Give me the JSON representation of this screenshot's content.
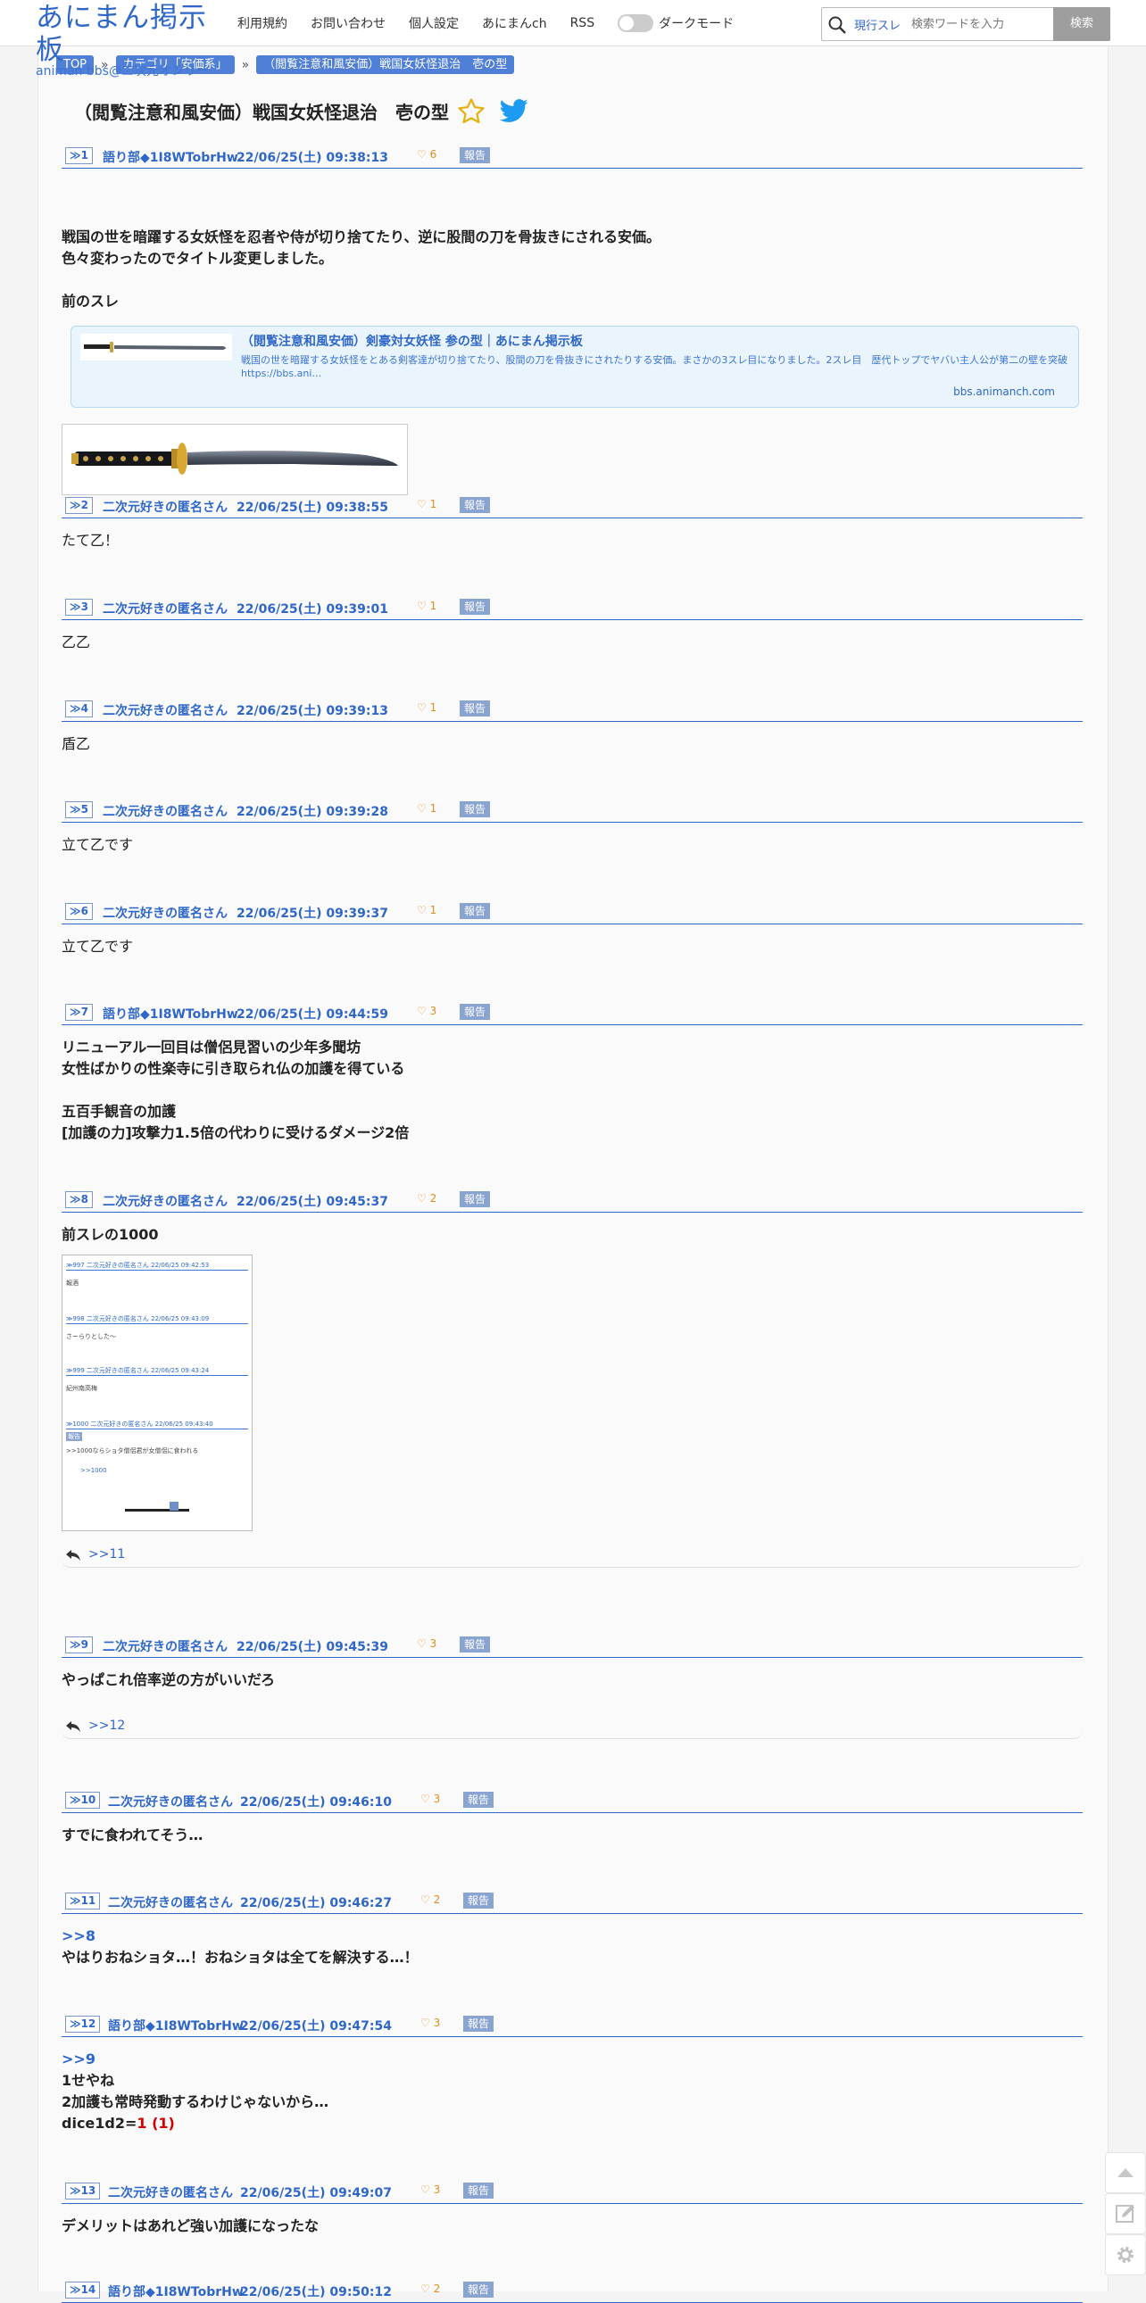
{
  "header": {
    "logo_title": "あにまん掲示板",
    "logo_subtitle": "animan bbs@二次元オンリー",
    "nav": [
      "利用規約",
      "お問い合わせ",
      "個人設定",
      "あにまんch",
      "RSS"
    ],
    "dark_mode_label": "ダークモード",
    "search_scope": "現行スレ",
    "search_placeholder": "検索ワードを入力",
    "search_button": "検索"
  },
  "breadcrumb": [
    "TOP",
    "カテゴリ「安価系」",
    "（閲覧注意和風安価）戦国女妖怪退治　壱の型"
  ],
  "thread_title": "（閲覧注意和風安価）戦国女妖怪退治　壱の型",
  "colors": {
    "accent": "#2f67c8",
    "like": "#e08d1f",
    "report": "#8aa4d2",
    "dice": "#d00000"
  },
  "posts": [
    {
      "num": "≫1",
      "name": "語り部◆1I8WTobrHw",
      "date": "22/06/25(土) 09:38:13",
      "likes": "6",
      "lines": [
        "戦国の世を暗躍する女妖怪を忍者や侍が切り捨てたり、逆に股間の刀を骨抜きにされる安価。",
        "色々変わったのでタイトル変更しました。",
        "",
        "前のスレ"
      ],
      "link_card": {
        "title": "（閲覧注意和風安価）剣豪対女妖怪 参の型｜あにまん掲示板",
        "desc": "戦国の世を暗躍する女妖怪をとある剣客達が切り捨てたり、股間の刀を骨抜きにされたりする安価。まさかの3スレ目になりました。2スレ目　歴代トップでヤバい主人公が第二の壁を突破https://bbs.ani…",
        "domain": "bbs.animanch.com"
      }
    },
    {
      "num": "≫2",
      "name": "二次元好きの匿名さん",
      "date": "22/06/25(土) 09:38:55",
      "likes": "1",
      "lines": [
        "たて乙！"
      ]
    },
    {
      "num": "≫3",
      "name": "二次元好きの匿名さん",
      "date": "22/06/25(土) 09:39:01",
      "likes": "1",
      "lines": [
        "乙乙"
      ]
    },
    {
      "num": "≫4",
      "name": "二次元好きの匿名さん",
      "date": "22/06/25(土) 09:39:13",
      "likes": "1",
      "lines": [
        "盾乙"
      ]
    },
    {
      "num": "≫5",
      "name": "二次元好きの匿名さん",
      "date": "22/06/25(土) 09:39:28",
      "likes": "1",
      "lines": [
        "立て乙です"
      ]
    },
    {
      "num": "≫6",
      "name": "二次元好きの匿名さん",
      "date": "22/06/25(土) 09:39:37",
      "likes": "1",
      "lines": [
        "立て乙です"
      ]
    },
    {
      "num": "≫7",
      "name": "語り部◆1I8WTobrHw",
      "date": "22/06/25(土) 09:44:59",
      "likes": "3",
      "lines": [
        "リニューアル一回目は僧侶見習いの少年多聞坊",
        "女性ばかりの性楽寺に引き取られ仏の加護を得ている",
        "",
        "五百手観音の加護",
        "[加護の力]攻撃力1.5倍の代わりに受けるダメージ2倍"
      ]
    },
    {
      "num": "≫8",
      "name": "二次元好きの匿名さん",
      "date": "22/06/25(土) 09:45:37",
      "likes": "2",
      "lines": [
        "前スレの1000"
      ],
      "replies": ">>11",
      "screenshot": {
        "rows": [
          {
            "meta": "≫997  二次元好きの匿名さん 22/06/25 09:42:53",
            "text": "報酒"
          },
          {
            "meta": "≫998  二次元好きの匿名さん 22/06/25 09:43:09",
            "text": "さーらりとした〜"
          },
          {
            "meta": "≫999  二次元好きの匿名さん 22/06/25 09:43:24",
            "text": "紀州南高梅"
          },
          {
            "meta": "≫1000  二次元好きの匿名さん 22/06/25 09:43:40",
            "text": ">>1000ならショタ僧侶君が女僧侶に食われる"
          }
        ],
        "reply": ">>1000",
        "report": "報告"
      }
    },
    {
      "num": "≫9",
      "name": "二次元好きの匿名さん",
      "date": "22/06/25(土) 09:45:39",
      "likes": "3",
      "lines": [
        "やっぱこれ倍率逆の方がいいだろ"
      ],
      "replies": ">>12"
    },
    {
      "num": "≫10",
      "name": "二次元好きの匿名さん",
      "date": "22/06/25(土) 09:46:10",
      "likes": "3",
      "lines": [
        "すでに食われてそう…"
      ]
    },
    {
      "num": "≫11",
      "name": "二次元好きの匿名さん",
      "date": "22/06/25(土) 09:46:27",
      "likes": "2",
      "anchor": ">>8",
      "lines": [
        "やはりおねショタ…！おねショタは全てを解決する…！"
      ]
    },
    {
      "num": "≫12",
      "name": "語り部◆1I8WTobrHw",
      "date": "22/06/25(土) 09:47:54",
      "likes": "3",
      "anchor": ">>9",
      "lines": [
        "1せやね",
        "2加護も常時発動するわけじゃないから…"
      ],
      "dice_prefix": "dice1d2=",
      "dice_result": "1 (1)"
    },
    {
      "num": "≫13",
      "name": "二次元好きの匿名さん",
      "date": "22/06/25(土) 09:49:07",
      "likes": "3",
      "lines": [
        "デメリットはあれど強い加護になったな"
      ]
    },
    {
      "num": "≫14",
      "name": "語り部◆1I8WTobrHw",
      "date": "22/06/25(土) 09:50:12",
      "likes": "2",
      "lines": []
    }
  ],
  "report_label": "報告",
  "icons": [
    "search-icon",
    "star-icon",
    "twitter-bird-icon",
    "heart-icon",
    "reply-arrow-icon",
    "scroll-top-icon",
    "compose-icon",
    "settings-gear-icon",
    "sword-image"
  ]
}
